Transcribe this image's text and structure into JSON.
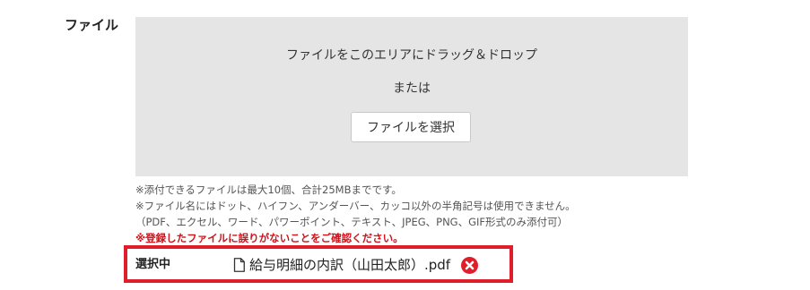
{
  "field": {
    "label": "ファイル"
  },
  "dropzone": {
    "instruction": "ファイルをこのエリアにドラッグ＆ドロップ",
    "or_text": "または",
    "select_button_label": "ファイルを選択"
  },
  "notes": [
    "※添付できるファイルは最大10個、合計25MBまでです。",
    "※ファイル名にはドット、ハイフン、アンダーバー、カッコ以外の半角記号は使用できません。",
    "（PDF、エクセル、ワード、パワーポイント、テキスト、JPEG、PNG、GIF形式のみ添付可）",
    "※登録したファイルに誤りがないことをご確認ください。"
  ],
  "selected": {
    "label": "選択中",
    "file_icon": "document-icon",
    "file_name": "給与明細の内訳（山田太郎）.pdf",
    "remove_icon": "remove-circle-x-icon"
  },
  "colors": {
    "dropzone_bg": "#e5e5e5",
    "warning_text": "#d0121b",
    "highlight_border": "#e01e2b",
    "remove_icon": "#e01e2b"
  }
}
